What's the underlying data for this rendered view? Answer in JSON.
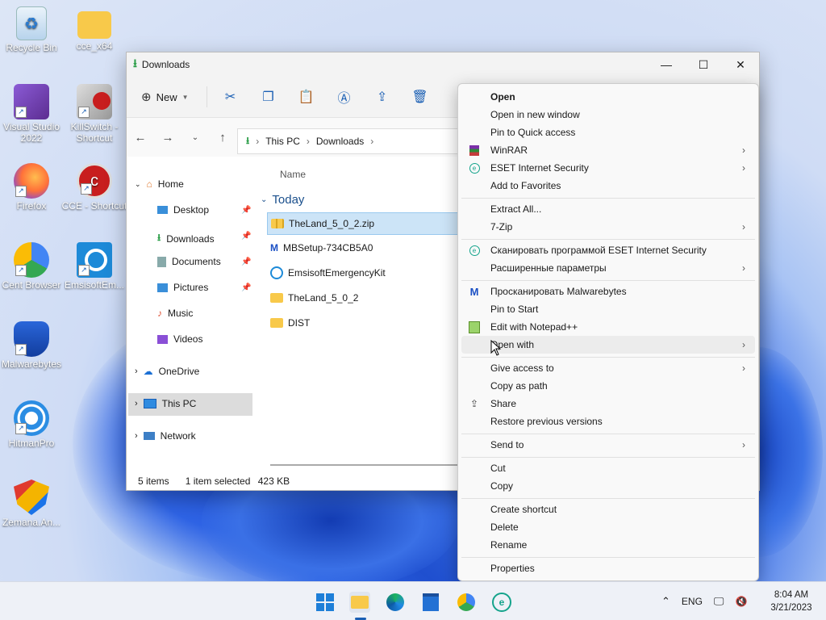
{
  "desktop": {
    "icons": [
      {
        "label": "Recycle Bin"
      },
      {
        "label": "cce_x64"
      },
      {
        "label": "Visual Studio 2022"
      },
      {
        "label": "KillSwitch - Shortcut"
      },
      {
        "label": "Firefox"
      },
      {
        "label": "CCE - Shortcut"
      },
      {
        "label": "Cent Browser"
      },
      {
        "label": "EmsisoftEm..."
      },
      {
        "label": "Malwarebytes"
      },
      {
        "label": "HitmanPro"
      },
      {
        "label": "Zemana.An..."
      }
    ]
  },
  "explorer": {
    "title": "Downloads",
    "toolbar": {
      "new_label": "New"
    },
    "address": {
      "root": "This PC",
      "folder": "Downloads"
    },
    "nav": {
      "home": "Home",
      "quick": [
        "Desktop",
        "Downloads",
        "Documents",
        "Pictures",
        "Music",
        "Videos"
      ],
      "onedrive": "OneDrive",
      "thispc": "This PC",
      "network": "Network"
    },
    "list": {
      "column_name": "Name",
      "group": "Today",
      "files": [
        "TheLand_5_0_2.zip",
        "MBSetup-734CB5A0",
        "EmsisoftEmergencyKit",
        "TheLand_5_0_2",
        "DIST"
      ]
    },
    "status": {
      "count": "5 items",
      "selected": "1 item selected",
      "size": "423 KB"
    }
  },
  "context_menu": {
    "items": [
      {
        "label": "Open",
        "bold": true
      },
      {
        "label": "Open in new window"
      },
      {
        "label": "Pin to Quick access"
      },
      {
        "label": "WinRAR",
        "submenu": true,
        "icon": "winrar-icon"
      },
      {
        "label": "ESET Internet Security",
        "submenu": true,
        "icon": "eset-icon"
      },
      {
        "label": "Add to Favorites"
      },
      {
        "label": "Extract All..."
      },
      {
        "label": "7-Zip",
        "submenu": true
      },
      {
        "label": "Сканировать программой ESET Internet Security",
        "icon": "eset-icon"
      },
      {
        "label": "Расширенные параметры",
        "submenu": true
      },
      {
        "label": "Просканировать Malwarebytes",
        "icon": "malwarebytes-icon"
      },
      {
        "label": "Pin to Start"
      },
      {
        "label": "Edit with Notepad++",
        "icon": "notepadpp-icon"
      },
      {
        "label": "Open with",
        "submenu": true
      },
      {
        "label": "Give access to",
        "submenu": true
      },
      {
        "label": "Copy as path"
      },
      {
        "label": "Share",
        "icon": "share-icon"
      },
      {
        "label": "Restore previous versions"
      },
      {
        "label": "Send to",
        "submenu": true
      },
      {
        "label": "Cut"
      },
      {
        "label": "Copy"
      },
      {
        "label": "Create shortcut"
      },
      {
        "label": "Delete"
      },
      {
        "label": "Rename"
      },
      {
        "label": "Properties"
      }
    ]
  },
  "taskbar": {
    "language": "ENG",
    "time": "8:04 AM",
    "date": "3/21/2023"
  },
  "colors": {
    "accent": "#1a5fb4",
    "selection": "#cce4f7",
    "folder": "#f8c94a"
  }
}
